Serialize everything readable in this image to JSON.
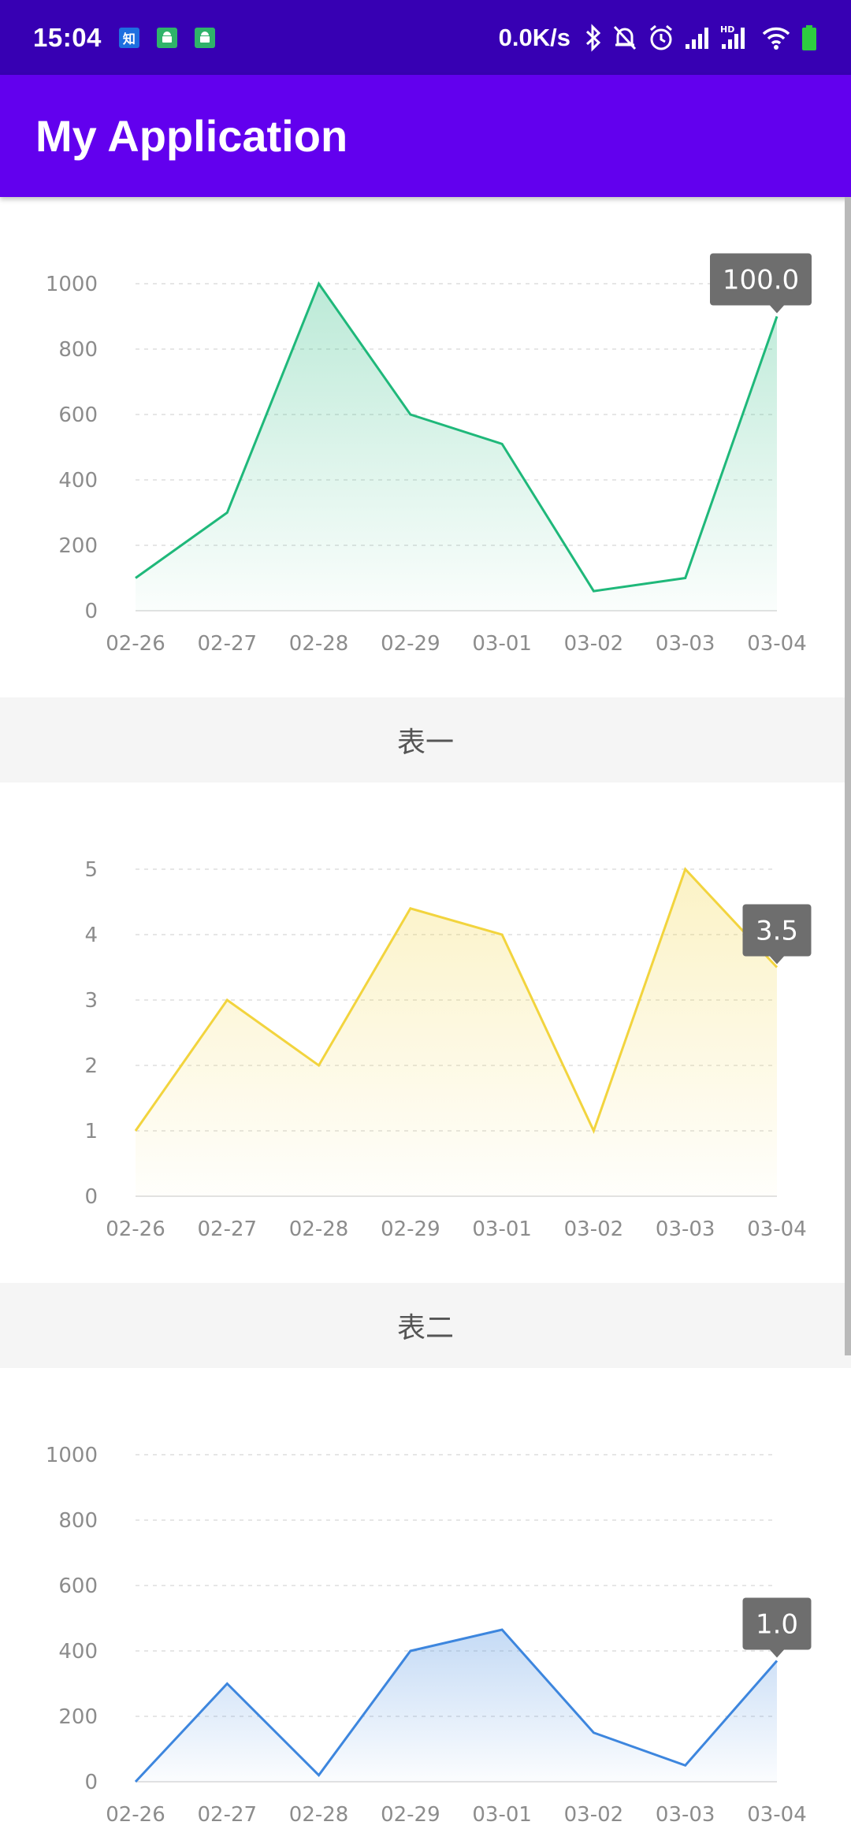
{
  "status_bar": {
    "time": "15:04",
    "net_speed": "0.0K/s",
    "notification_icons": [
      "zhihu-icon",
      "android-app-icon",
      "android-app-icon"
    ],
    "zhihu_glyph": "知",
    "system_icons": [
      "bluetooth-icon",
      "mute-bell-icon",
      "alarm-icon",
      "signal-icon",
      "hd-signal-icon",
      "wifi-icon",
      "battery-icon"
    ],
    "colors": {
      "background": "#3700b3",
      "battery": "#2ecc40"
    }
  },
  "app_bar": {
    "title": "My Application",
    "color": "#6200ee"
  },
  "sections": [
    {
      "caption": "表一"
    },
    {
      "caption": "表二"
    }
  ],
  "chart_data": [
    {
      "type": "area",
      "categories": [
        "02-26",
        "02-27",
        "02-28",
        "02-29",
        "03-01",
        "03-02",
        "03-03",
        "03-04"
      ],
      "values": [
        100,
        300,
        1000,
        600,
        510,
        60,
        100,
        900
      ],
      "y_ticks": [
        "0",
        "200",
        "400",
        "600",
        "800",
        "1000"
      ],
      "ylim": [
        0,
        1000
      ],
      "color": "#1fb87a",
      "grid": true,
      "tooltip": "100.0"
    },
    {
      "type": "area",
      "categories": [
        "02-26",
        "02-27",
        "02-28",
        "02-29",
        "03-01",
        "03-02",
        "03-03",
        "03-04"
      ],
      "values": [
        1,
        3,
        2,
        4.4,
        4,
        1,
        5,
        3.5
      ],
      "y_ticks": [
        "0",
        "1",
        "2",
        "3",
        "4",
        "5"
      ],
      "ylim": [
        0,
        5
      ],
      "color": "#f2d43e",
      "grid": true,
      "tooltip": "3.5"
    },
    {
      "type": "area",
      "categories": [
        "02-26",
        "02-27",
        "02-28",
        "02-29",
        "03-01",
        "03-02",
        "03-03",
        "03-04"
      ],
      "values": [
        0,
        300,
        20,
        400,
        465,
        150,
        50,
        370
      ],
      "y_ticks": [
        "0",
        "200",
        "400",
        "600",
        "800",
        "1000"
      ],
      "ylim": [
        0,
        1000
      ],
      "color": "#3d86de",
      "grid": true,
      "tooltip": "1.0"
    }
  ]
}
